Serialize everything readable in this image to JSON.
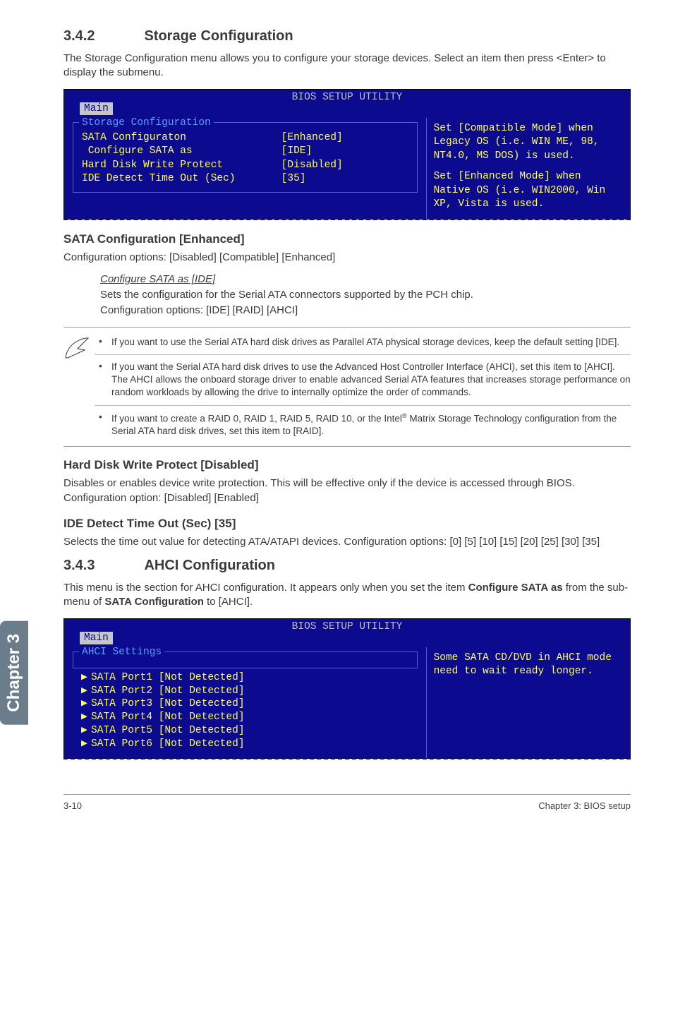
{
  "heading342": {
    "num": "3.4.2",
    "title": "Storage Configuration"
  },
  "intro342": "The Storage Configuration menu allows you to configure your storage devices. Select an item then press <Enter> to display the submenu.",
  "bios1": {
    "header": "BIOS SETUP UTILITY",
    "tab": "Main",
    "frameTitle": "Storage Configuration",
    "rows": [
      {
        "label": "SATA Configuraton",
        "value": "[Enhanced]"
      },
      {
        "label": " Configure SATA as",
        "value": "[IDE]"
      },
      {
        "label": "",
        "value": ""
      },
      {
        "label": "Hard Disk Write Protect",
        "value": "[Disabled]"
      },
      {
        "label": "IDE Detect Time Out (Sec)",
        "value": "[35]"
      }
    ],
    "help1": "Set [Compatible Mode] when Legacy OS (i.e. WIN ME, 98, NT4.0, MS DOS) is used.",
    "help2": "Set [Enhanced Mode] when Native OS (i.e. WIN2000, Win XP, Vista is used."
  },
  "sataCfg": {
    "title": "SATA Configuration [Enhanced]",
    "body": "Configuration options: [Disabled] [Compatible] [Enhanced]",
    "subTitle": "Configure SATA as [IDE]",
    "subBody1": "Sets the configuration for the Serial ATA connectors supported by the PCH chip.",
    "subBody2": "Configuration options: [IDE] [RAID] [AHCI]"
  },
  "notes": {
    "n1": "If you want to use the Serial ATA hard disk drives as Parallel ATA physical storage devices, keep the default setting [IDE].",
    "n2": "If you want the Serial ATA hard disk drives to use the Advanced Host Controller Interface (AHCI), set this item to [AHCI]. The AHCI allows the onboard storage driver to enable advanced Serial ATA features that increases storage performance on random workloads by allowing the drive to internally optimize the order of commands.",
    "n3a": "If you want to create a RAID 0, RAID 1, RAID 5, RAID 10, or the Intel",
    "n3b": " Matrix Storage Technology configuration from the Serial ATA hard disk drives, set this item to [RAID]."
  },
  "hardDisk": {
    "title": "Hard Disk Write Protect [Disabled]",
    "body": "Disables or enables device write protection. This will be effective only if the device is accessed through BIOS. Configuration option: [Disabled] [Enabled]"
  },
  "ideDetect": {
    "title": "IDE Detect Time Out (Sec) [35]",
    "body": "Selects the time out value for detecting ATA/ATAPI devices. Configuration options: [0] [5] [10] [15] [20] [25] [30] [35]"
  },
  "heading343": {
    "num": "3.4.3",
    "title": "AHCI Configuration"
  },
  "intro343a": "This menu is the section for AHCI configuration. It appears only when you set the item ",
  "intro343b": "Configure SATA as",
  "intro343c": " from the sub-menu of ",
  "intro343d": "SATA Configuration",
  "intro343e": " to [AHCI].",
  "bios2": {
    "header": "BIOS SETUP UTILITY",
    "tab": "Main",
    "frameTitle": "AHCI Settings",
    "items": [
      "SATA Port1 [Not Detected]",
      "SATA Port2 [Not Detected]",
      "SATA Port3 [Not Detected]",
      "SATA Port4 [Not Detected]",
      "SATA Port5 [Not Detected]",
      "SATA Port6 [Not Detected]"
    ],
    "help": "Some SATA CD/DVD in AHCI mode need to wait ready longer."
  },
  "chapterTab": "Chapter 3",
  "footer": {
    "left": "3-10",
    "right": "Chapter 3: BIOS setup"
  }
}
